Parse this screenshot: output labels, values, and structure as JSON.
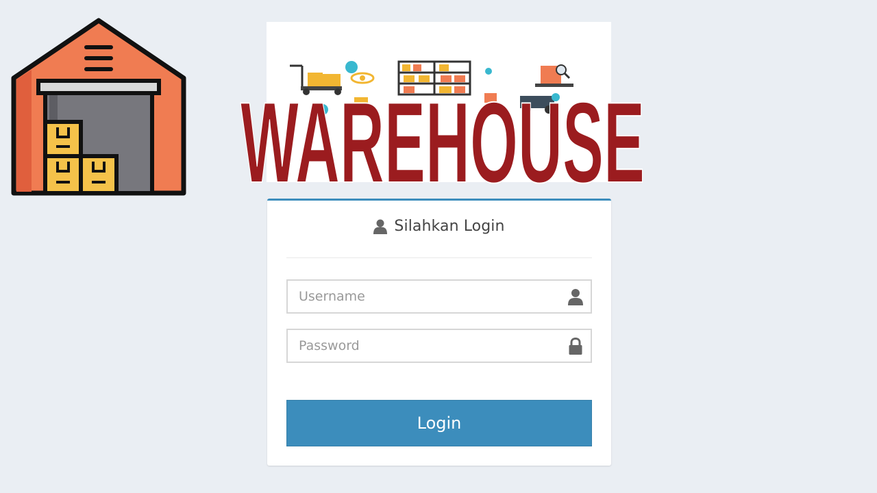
{
  "brand": {
    "wordmark": "WAREHOUSE",
    "wordmark_color": "#9b1c1f",
    "logo_icon": "warehouse-icon"
  },
  "login": {
    "title": "Silahkan Login",
    "title_icon": "user-icon",
    "username_placeholder": "Username",
    "username_icon": "user-icon",
    "password_placeholder": "Password",
    "password_icon": "lock-icon",
    "button_label": "Login"
  },
  "colors": {
    "page_bg": "#eaeef3",
    "accent": "#3c8dbc",
    "logo_orange": "#f07c52"
  }
}
